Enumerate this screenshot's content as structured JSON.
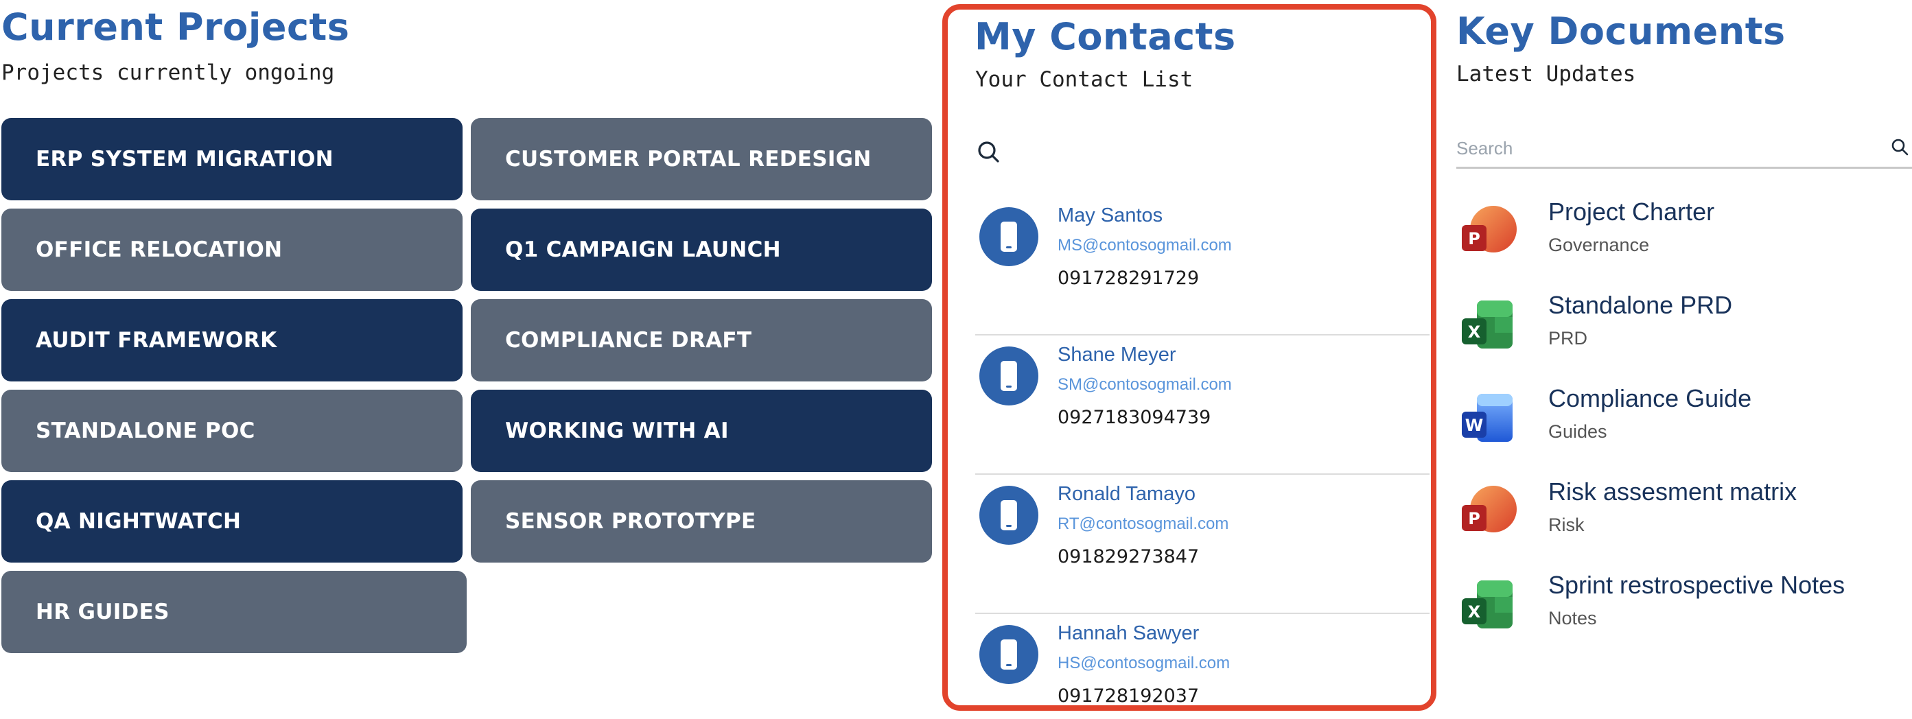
{
  "projects": {
    "title": "Current Projects",
    "subtitle": "Projects currently ongoing",
    "items": [
      {
        "label": "ERP SYSTEM MIGRATION",
        "tone": "dark"
      },
      {
        "label": "CUSTOMER PORTAL REDESIGN",
        "tone": "gray"
      },
      {
        "label": "OFFICE RELOCATION",
        "tone": "gray"
      },
      {
        "label": "Q1 CAMPAIGN LAUNCH",
        "tone": "dark"
      },
      {
        "label": "AUDIT FRAMEWORK",
        "tone": "dark"
      },
      {
        "label": "COMPLIANCE DRAFT",
        "tone": "gray"
      },
      {
        "label": "STANDALONE POC",
        "tone": "gray"
      },
      {
        "label": "WORKING WITH AI",
        "tone": "dark"
      },
      {
        "label": "QA NIGHTWATCH",
        "tone": "dark"
      },
      {
        "label": "SENSOR PROTOTYPE",
        "tone": "gray"
      },
      {
        "label": "HR GUIDES",
        "tone": "gray"
      }
    ]
  },
  "contacts": {
    "title": "My Contacts",
    "subtitle": "Your Contact List",
    "items": [
      {
        "name": "May Santos",
        "email": "MS@contosogmail.com",
        "phone": "091728291729"
      },
      {
        "name": "Shane Meyer",
        "email": "SM@contosogmail.com",
        "phone": "0927183094739"
      },
      {
        "name": "Ronald Tamayo",
        "email": "RT@contosogmail.com",
        "phone": "091829273847"
      },
      {
        "name": "Hannah Sawyer",
        "email": "HS@contosogmail.com",
        "phone": "091728192037"
      }
    ]
  },
  "documents": {
    "title": "Key Documents",
    "subtitle": "Latest Updates",
    "search": {
      "placeholder": "Search",
      "value": ""
    },
    "items": [
      {
        "title": "Project Charter",
        "category": "Governance",
        "icon": "powerpoint-icon"
      },
      {
        "title": "Standalone PRD",
        "category": "PRD",
        "icon": "excel-icon"
      },
      {
        "title": "Compliance Guide",
        "category": "Guides",
        "icon": "word-icon"
      },
      {
        "title": "Risk assesment matrix",
        "category": "Risk",
        "icon": "powerpoint-icon"
      },
      {
        "title": "Sprint restrospective Notes",
        "category": "Notes",
        "icon": "excel-icon"
      }
    ]
  },
  "colors": {
    "title_blue": "#2e63ac",
    "tile_dark": "#18325a",
    "tile_gray": "#5a6677",
    "highlight_border": "#e2432c"
  }
}
